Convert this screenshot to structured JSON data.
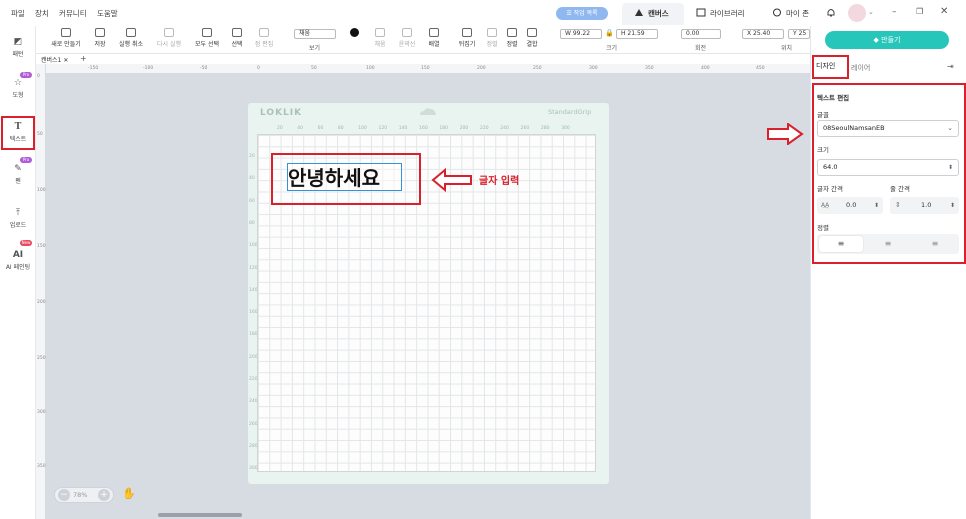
{
  "menu": [
    "파일",
    "장치",
    "커뮤니티",
    "도움말"
  ],
  "task_list_label": "☰ 작업 목록",
  "top_tabs": [
    "캔버스",
    "라이브러리",
    "마이 존"
  ],
  "toolbar": {
    "new": "새로 만들기",
    "save": "저장",
    "undo": "실행 취소",
    "redo": "다시 실행",
    "select_all": "모두 선택",
    "select": "선택",
    "point_edit": "점 편집",
    "view_value": "채움",
    "view_label": "보기",
    "fill": "채움",
    "outline": "윤곽선",
    "arrange": "배열",
    "flip": "뒤집기",
    "align": "정렬",
    "sort": "정렬",
    "combine": "결합",
    "width_value": "W 99.22",
    "height_value": "H 21.59",
    "size_label": "크기",
    "rotate_value": "0.00",
    "rotate_label": "회전",
    "x_value": "X 25.40",
    "y_value": "Y 25",
    "position_label": "위치"
  },
  "sidebar": {
    "items": [
      "패턴",
      "도형",
      "텍스트",
      "펜",
      "업로드",
      "AI 페인팅"
    ],
    "pro_badge": "Pro",
    "new_badge": "New"
  },
  "canvas": {
    "tab_label": "캔버스1",
    "add_tab": "+",
    "mat_logo": "LOKLIK",
    "mat_name": "StandardGrip",
    "text_value": "안녕하세요",
    "annotation": "글자 입력",
    "zoom_value": "78%"
  },
  "ruler": {
    "top": [
      "-150",
      "-100",
      "-50",
      "0",
      "50",
      "100",
      "150",
      "200",
      "250",
      "300",
      "350",
      "400",
      "450"
    ],
    "left": [
      "0",
      "50",
      "100",
      "150",
      "200",
      "250",
      "300",
      "350"
    ],
    "mat_top": [
      "20",
      "40",
      "60",
      "80",
      "100",
      "120",
      "140",
      "160",
      "180",
      "200",
      "220",
      "240",
      "260",
      "280",
      "300"
    ],
    "mat_left": [
      "20",
      "40",
      "60",
      "80",
      "100",
      "120",
      "140",
      "160",
      "180",
      "200",
      "220",
      "240",
      "260",
      "280",
      "300"
    ]
  },
  "right_panel": {
    "make_button": "만들기",
    "tab_design": "디자인",
    "tab_layer": "레이어",
    "section_title": "텍스트 편집",
    "font_label": "글꼴",
    "font_value": "08SeoulNamsanEB",
    "size_label": "크기",
    "size_value": "64.0",
    "letter_spacing_label": "글자 간격",
    "letter_spacing_value": "0.0",
    "line_spacing_label": "줄 간격",
    "line_spacing_value": "1.0",
    "align_label": "정렬"
  },
  "colors": {
    "accent": "#27c6bb",
    "highlight": "#d9202b",
    "task_button": "#8fb8f0"
  }
}
